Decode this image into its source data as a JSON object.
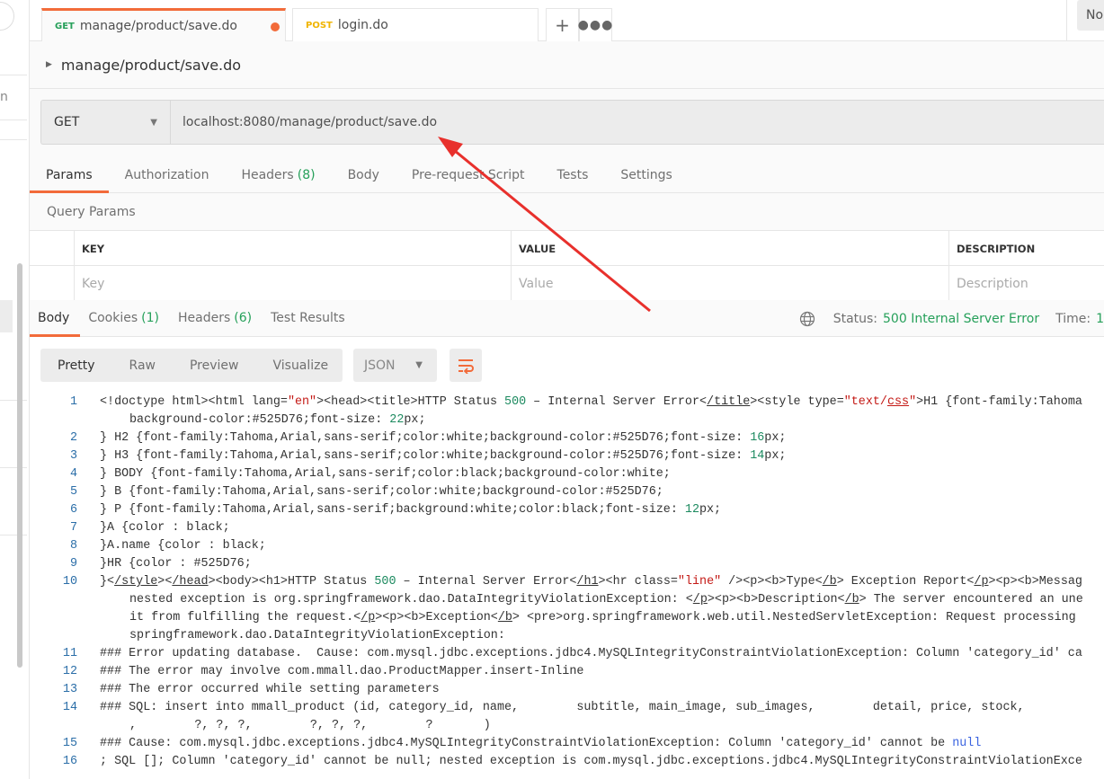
{
  "tabs": [
    {
      "method": "GET",
      "method_color": "#26a05a",
      "label": "manage/product/save.do",
      "unsaved": true,
      "active": true
    },
    {
      "method": "POST",
      "method_color": "#f0b400",
      "label": "login.do",
      "unsaved": false,
      "active": false
    }
  ],
  "tab_actions": {
    "new_tab_icon": "plus-icon",
    "more_icon": "ellipsis-icon"
  },
  "environment": {
    "label": "No"
  },
  "sidebar": {
    "partial_text": "n"
  },
  "breadcrumb": {
    "title": "manage/product/save.do"
  },
  "request": {
    "method": "GET",
    "url": "localhost:8080/manage/product/save.do"
  },
  "request_tabs": [
    {
      "label": "Params",
      "count": ""
    },
    {
      "label": "Authorization",
      "count": ""
    },
    {
      "label": "Headers",
      "count": "(8)"
    },
    {
      "label": "Body",
      "count": ""
    },
    {
      "label": "Pre-request Script",
      "count": ""
    },
    {
      "label": "Tests",
      "count": ""
    },
    {
      "label": "Settings",
      "count": ""
    }
  ],
  "query_params": {
    "title": "Query Params",
    "columns": [
      "KEY",
      "VALUE",
      "DESCRIPTION"
    ],
    "placeholders": [
      "Key",
      "Value",
      "Description"
    ]
  },
  "response_tabs": [
    {
      "label": "Body",
      "count": ""
    },
    {
      "label": "Cookies",
      "count": "(1)"
    },
    {
      "label": "Headers",
      "count": "(6)"
    },
    {
      "label": "Test Results",
      "count": ""
    }
  ],
  "response_status": {
    "status_label": "Status:",
    "status_value": "500 Internal Server Error",
    "time_label": "Time:",
    "time_value": "1"
  },
  "response_view": {
    "modes": [
      "Pretty",
      "Raw",
      "Preview",
      "Visualize"
    ],
    "active": "Pretty",
    "format": "JSON"
  },
  "colors": {
    "accent": "#f26b3a",
    "success": "#26a05a",
    "annotation_arrow": "#e8302c"
  },
  "code_lines": [
    {
      "num": "1",
      "rows": [
        [
          [
            "<!doctype html><html lang=",
            ""
          ],
          [
            "\"en\"",
            "s"
          ],
          [
            "><head><title>HTTP Status ",
            ""
          ],
          [
            "500",
            "n"
          ],
          [
            " – Internal Server Error<",
            ""
          ],
          [
            "/title",
            "u"
          ],
          [
            "><style type=",
            ""
          ],
          [
            "\"text/",
            "s"
          ],
          [
            "css",
            "su"
          ],
          [
            "\"",
            "s"
          ],
          [
            ">H1 {font-family:Tahoma",
            ""
          ]
        ],
        [
          [
            "background-color:#525D76;font-size: ",
            ""
          ],
          [
            "22",
            "n"
          ],
          [
            "px;",
            ""
          ]
        ]
      ]
    },
    {
      "num": "2",
      "rows": [
        [
          [
            "} H2 {font-family:Tahoma,Arial,sans-serif;color:white;background-color:#525D76;font-size: ",
            ""
          ],
          [
            "16",
            "n"
          ],
          [
            "px;",
            ""
          ]
        ]
      ]
    },
    {
      "num": "3",
      "rows": [
        [
          [
            "} H3 {font-family:Tahoma,Arial,sans-serif;color:white;background-color:#525D76;font-size: ",
            ""
          ],
          [
            "14",
            "n"
          ],
          [
            "px;",
            ""
          ]
        ]
      ]
    },
    {
      "num": "4",
      "rows": [
        [
          [
            "} BODY {font-family:Tahoma,Arial,sans-serif;color:black;background-color:white;",
            ""
          ]
        ]
      ]
    },
    {
      "num": "5",
      "rows": [
        [
          [
            "} B {font-family:Tahoma,Arial,sans-serif;color:white;background-color:#525D76;",
            ""
          ]
        ]
      ]
    },
    {
      "num": "6",
      "rows": [
        [
          [
            "} P {font-family:Tahoma,Arial,sans-serif;background:white;color:black;font-size: ",
            ""
          ],
          [
            "12",
            "n"
          ],
          [
            "px;",
            ""
          ]
        ]
      ]
    },
    {
      "num": "7",
      "rows": [
        [
          [
            "}A {color : black;",
            ""
          ]
        ]
      ]
    },
    {
      "num": "8",
      "rows": [
        [
          [
            "}A.name {color : black;",
            ""
          ]
        ]
      ]
    },
    {
      "num": "9",
      "rows": [
        [
          [
            "}HR {color : #525D76;",
            ""
          ]
        ]
      ]
    },
    {
      "num": "10",
      "rows": [
        [
          [
            "}<",
            ""
          ],
          [
            "/style",
            "u"
          ],
          [
            "><",
            ""
          ],
          [
            "/head",
            "u"
          ],
          [
            "><body><h1>HTTP Status ",
            ""
          ],
          [
            "500",
            "n"
          ],
          [
            " – Internal Server Error<",
            ""
          ],
          [
            "/h1",
            "u"
          ],
          [
            "><hr class=",
            ""
          ],
          [
            "\"line\"",
            "s"
          ],
          [
            " /><p><b>Type<",
            ""
          ],
          [
            "/b",
            "u"
          ],
          [
            "> Exception Report<",
            ""
          ],
          [
            "/p",
            "u"
          ],
          [
            "><p><b>Messag",
            ""
          ]
        ],
        [
          [
            "nested exception is org.springframework.dao.DataIntegrityViolationException: <",
            ""
          ],
          [
            "/p",
            "u"
          ],
          [
            "><p><b>Description<",
            ""
          ],
          [
            "/b",
            "u"
          ],
          [
            "> The server encountered an une",
            ""
          ]
        ],
        [
          [
            "it from fulfilling the request.<",
            ""
          ],
          [
            "/p",
            "u"
          ],
          [
            "><p><b>Exception<",
            ""
          ],
          [
            "/b",
            "u"
          ],
          [
            "> <pre>org.springframework.web.util.NestedServletException: Request processing",
            ""
          ]
        ],
        [
          [
            "springframework.dao.DataIntegrityViolationException:",
            ""
          ]
        ]
      ]
    },
    {
      "num": "11",
      "rows": [
        [
          [
            "### Error updating database.  Cause: com.mysql.jdbc.exceptions.jdbc4.MySQLIntegrityConstraintViolationException: Column 'category_id' ca",
            ""
          ]
        ]
      ]
    },
    {
      "num": "12",
      "rows": [
        [
          [
            "### The error may involve com.mmall.dao.ProductMapper.insert-Inline",
            ""
          ]
        ]
      ]
    },
    {
      "num": "13",
      "rows": [
        [
          [
            "### The error occurred while setting parameters",
            ""
          ]
        ]
      ]
    },
    {
      "num": "14",
      "rows": [
        [
          [
            "### SQL: insert into mmall_product (id, category_id, name,        subtitle, main_image, sub_images,        detail, price, stock,",
            ""
          ]
        ],
        [
          [
            ",        ?, ?, ?,        ?, ?, ?,        ?       )",
            ""
          ]
        ]
      ]
    },
    {
      "num": "15",
      "rows": [
        [
          [
            "### Cause: com.mysql.jdbc.exceptions.jdbc4.MySQLIntegrityConstraintViolationException: Column 'category_id' cannot be ",
            ""
          ],
          [
            "null",
            "k"
          ]
        ]
      ]
    },
    {
      "num": "16",
      "rows": [
        [
          [
            "; SQL []; Column 'category_id' cannot be null; nested exception is com.mysql.jdbc.exceptions.jdbc4.MySQLIntegrityConstraintViolationExce",
            ""
          ]
        ]
      ]
    }
  ]
}
